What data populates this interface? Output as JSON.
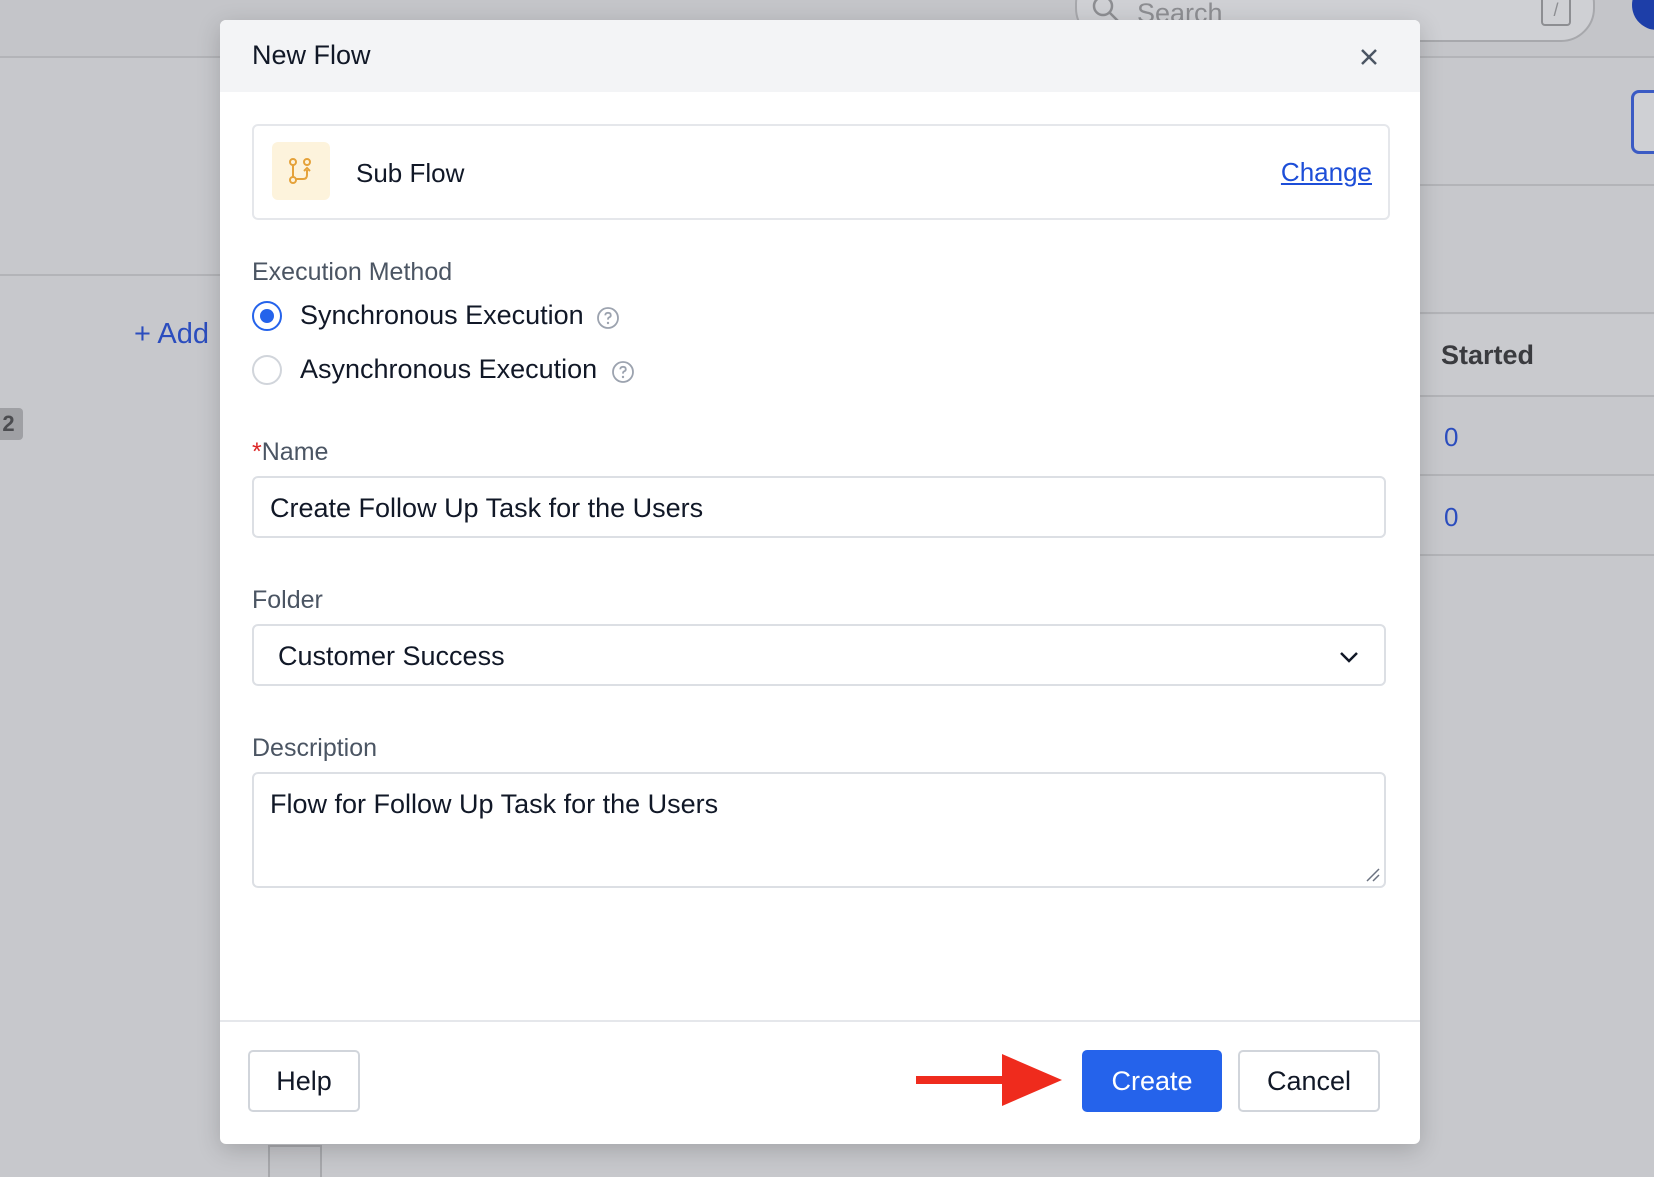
{
  "background": {
    "search_placeholder": "Search",
    "search_shortcut": "/",
    "add_label": "+ Add",
    "badge_count": "2",
    "table_header_started": "Started",
    "table_values": [
      "0",
      "0"
    ]
  },
  "modal": {
    "title": "New Flow",
    "flow_type": {
      "label": "Sub Flow",
      "change_label": "Change",
      "icon": "sub-flow-icon"
    },
    "execution_method": {
      "label": "Execution Method",
      "options": [
        {
          "label": "Synchronous Execution",
          "selected": true
        },
        {
          "label": "Asynchronous Execution",
          "selected": false
        }
      ]
    },
    "name": {
      "required_mark": "*",
      "label": "Name",
      "value": "Create Follow Up Task for the Users"
    },
    "folder": {
      "label": "Folder",
      "value": "Customer Success"
    },
    "description": {
      "label": "Description",
      "value": "Flow for Follow Up Task for the Users"
    },
    "buttons": {
      "help": "Help",
      "create": "Create",
      "cancel": "Cancel"
    }
  },
  "colors": {
    "primary": "#2563eb",
    "link": "#1d4ed8",
    "required": "#dc2626",
    "annotation_arrow": "#ef2b1d",
    "icon_bg": "#fdf3dc",
    "icon_fg": "#e5a23a"
  }
}
